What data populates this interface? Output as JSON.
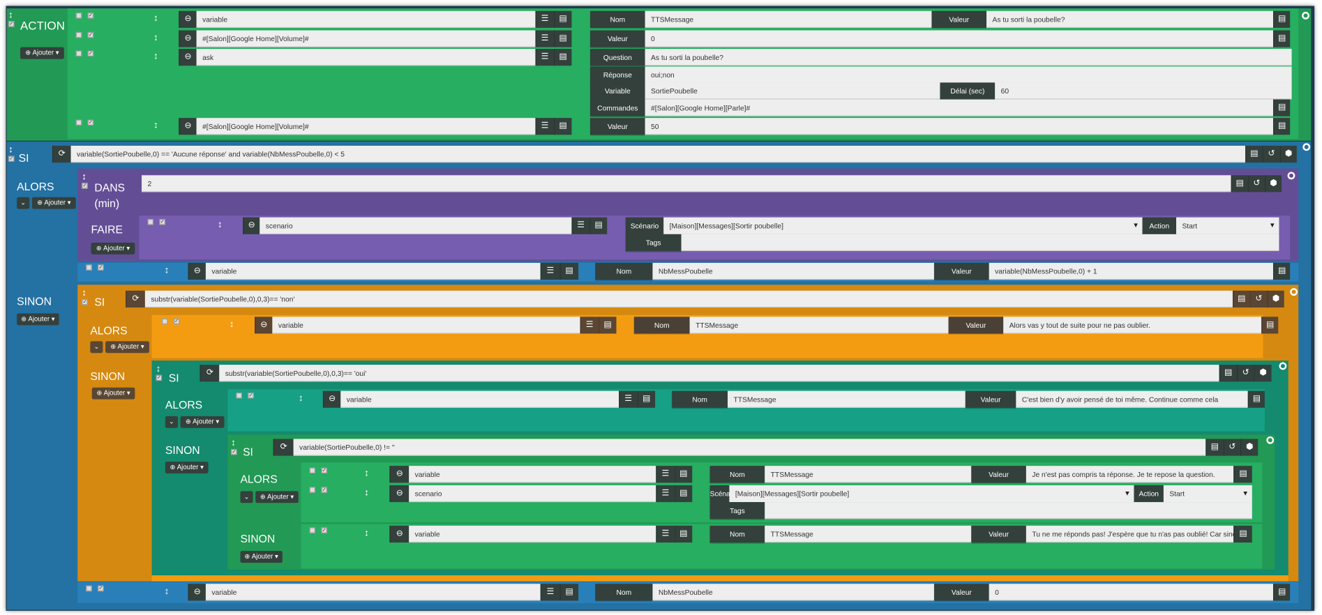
{
  "common": {
    "add": "Ajouter",
    "alors": "ALORS",
    "sinon": "SINON",
    "si": "SI",
    "nom": "Nom",
    "valeur": "Valeur",
    "scenario_label": "Scénario",
    "action_label": "Action",
    "tags_label": "Tags"
  },
  "action": {
    "title": "ACTION",
    "rows": [
      {
        "type": "variable",
        "nom": "TTSMessage",
        "valeur": "As tu sorti la poubelle?"
      },
      {
        "type": "#[Salon][Google Home][Volume]#",
        "valeur": "0"
      },
      {
        "type": "ask",
        "question_label": "Question",
        "question": "As tu sorti la poubelle?",
        "reponse_label": "Réponse",
        "reponse": "oui;non",
        "variable_label": "Variable",
        "variable": "SortiePoubelle",
        "delai_label": "Délai (sec)",
        "delai": "60",
        "commandes_label": "Commandes",
        "commandes": "#[Salon][Google Home][Parle]#"
      },
      {
        "type": "#[Salon][Google Home][Volume]#",
        "valeur": "50"
      }
    ]
  },
  "si1": {
    "condition": "variable(SortiePoubelle,0) == 'Aucune réponse' and variable(NbMessPoubelle,0) < 5",
    "dans": {
      "label": "DANS",
      "unit": "(min)",
      "value": "2",
      "faire": "FAIRE",
      "row": {
        "type": "scenario",
        "scenario": "[Maison][Messages][Sortir poubelle]",
        "action": "Start",
        "tags": ""
      }
    },
    "alors_row": {
      "type": "variable",
      "nom": "NbMessPoubelle",
      "valeur": "variable(NbMessPoubelle,0) + 1"
    },
    "sinon_row": {
      "type": "variable",
      "nom": "NbMessPoubelle",
      "valeur": "0"
    }
  },
  "si2": {
    "condition": "substr(variable(SortiePoubelle,0),0,3)== 'non'",
    "alors_row": {
      "type": "variable",
      "nom": "TTSMessage",
      "valeur": "Alors vas y tout de suite pour ne pas oublier."
    }
  },
  "si3": {
    "condition": "substr(variable(SortiePoubelle,0),0,3)== 'oui'",
    "alors_row": {
      "type": "variable",
      "nom": "TTSMessage",
      "valeur": "C'est bien d'y avoir pensé de toi même. Continue comme cela"
    }
  },
  "si4": {
    "condition": "variable(SortiePoubelle,0) != ''",
    "alors_rows": [
      {
        "type": "variable",
        "nom": "TTSMessage",
        "valeur": "Je n'est pas compris ta réponse. Je te repose la question."
      },
      {
        "type": "scenario",
        "scenario": "[Maison][Messages][Sortir poubelle]",
        "action": "Start",
        "tags": ""
      }
    ],
    "sinon_row": {
      "type": "variable",
      "nom": "TTSMessage",
      "valeur": "Tu ne me réponds pas! J'espère que tu n'as pas oublié! Car sinon"
    }
  },
  "colors": {
    "action": "#27ae60",
    "si_blue": "#2471a3",
    "dans_purple": "#634e96",
    "si_orange": "#d68910",
    "si_teal": "#148a6e",
    "si_green": "#229954"
  },
  "icons": [
    "minus-circle-icon",
    "list-icon",
    "card-icon",
    "refresh-icon",
    "history-icon",
    "cube-icon",
    "move-icon",
    "chevron-down-icon",
    "plus-circle-icon",
    "caret-down-icon",
    "checkbox-icon"
  ]
}
